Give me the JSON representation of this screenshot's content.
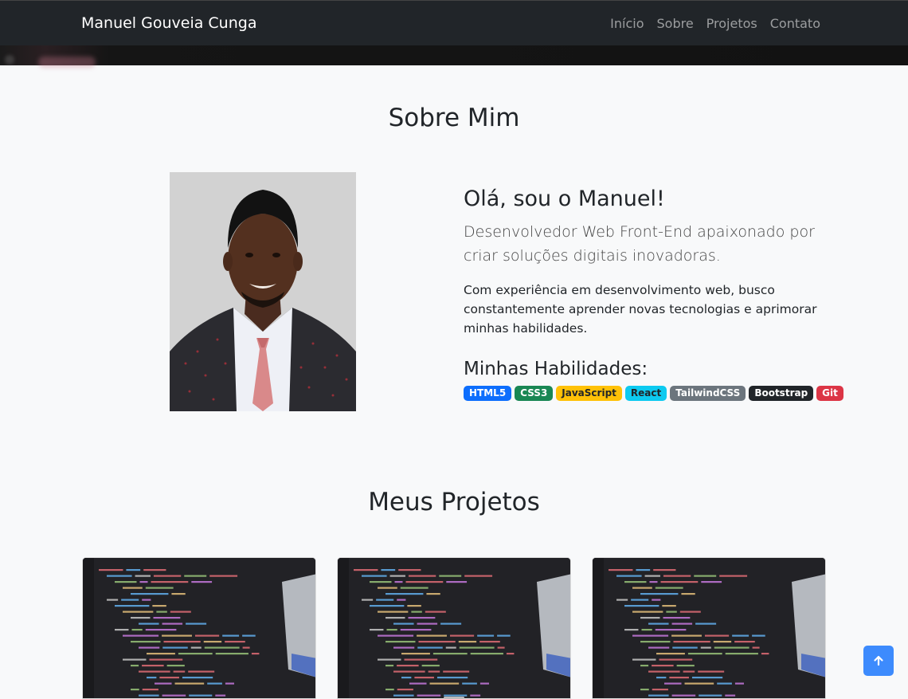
{
  "nav": {
    "brand": "Manuel Gouveia Cunga",
    "links": [
      "Início",
      "Sobre",
      "Projetos",
      "Contato"
    ]
  },
  "about": {
    "title": "Sobre Mim",
    "greeting": "Olá, sou o Manuel!",
    "lead": "Desenvolvedor Web Front-End apaixonado por criar soluções digitais inovadoras.",
    "description": "Com experiência em desenvolvimento web, busco constantemente aprender novas tecnologias e aprimorar minhas habilidades.",
    "skills_title": "Minhas Habilidades:",
    "skills": [
      {
        "label": "HTML5",
        "color": "#0d6efd",
        "text_color": "#ffffff"
      },
      {
        "label": "CSS3",
        "color": "#198754",
        "text_color": "#ffffff"
      },
      {
        "label": "JavaScript",
        "color": "#ffc107",
        "text_color": "#212529"
      },
      {
        "label": "React",
        "color": "#0dcaf0",
        "text_color": "#212529"
      },
      {
        "label": "TailwindCSS",
        "color": "#6c757d",
        "text_color": "#ffffff"
      },
      {
        "label": "Bootstrap",
        "color": "#212529",
        "text_color": "#ffffff"
      },
      {
        "label": "Git",
        "color": "#dc3545",
        "text_color": "#ffffff"
      }
    ]
  },
  "projects": {
    "title": "Meus Projetos"
  },
  "icons": {
    "back_to_top": "arrow-up-icon"
  },
  "colors": {
    "navbar": "#212529",
    "page_bg": "#f8f9fa",
    "back_to_top": "#3d8bfd"
  }
}
